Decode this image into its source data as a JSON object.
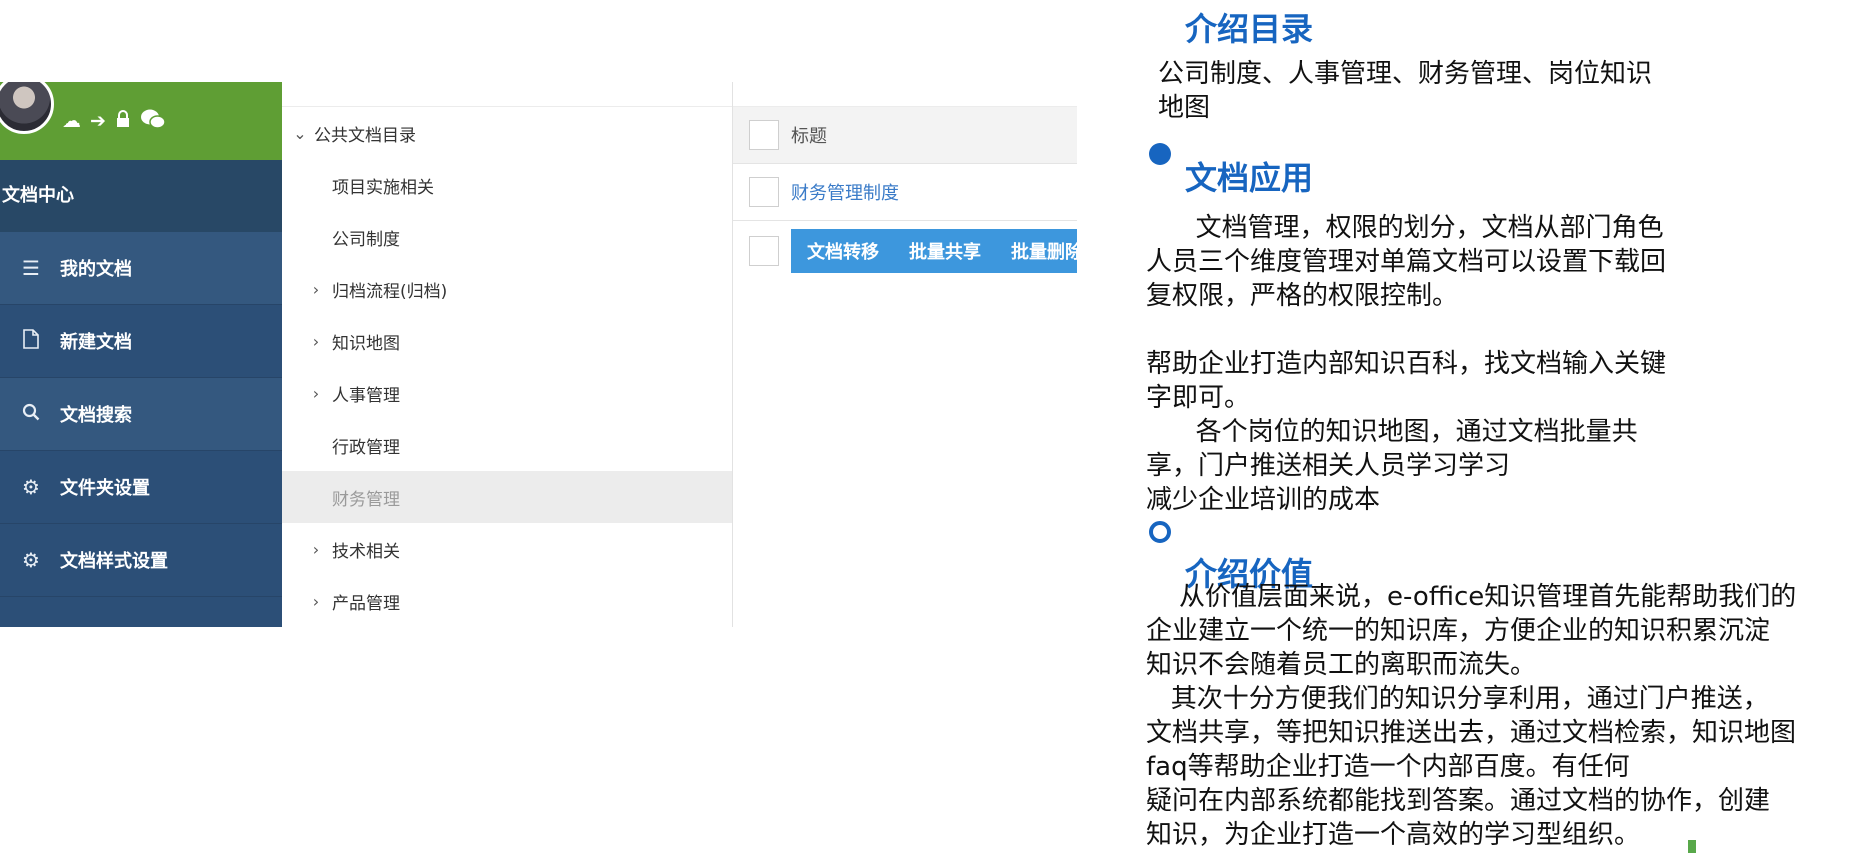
{
  "screenshot": {
    "user_bar": {
      "icons": [
        "cloud-icon",
        "sign-in-icon",
        "lock-icon",
        "wechat-icon"
      ]
    },
    "nav_header": "文档中心",
    "nav_items": [
      {
        "label": "我的文档",
        "icon": "list-icon"
      },
      {
        "label": "新建文档",
        "icon": "file-icon"
      },
      {
        "label": "文档搜索",
        "icon": "search-icon"
      },
      {
        "label": "文件夹设置",
        "icon": "gear-icon"
      },
      {
        "label": "文档样式设置",
        "icon": "gear-icon"
      }
    ],
    "tree": {
      "root": "公共文档目录",
      "items": [
        {
          "label": "项目实施相关",
          "expandable": false
        },
        {
          "label": "公司制度",
          "expandable": false
        },
        {
          "label": "归档流程(归档)",
          "expandable": true
        },
        {
          "label": "知识地图",
          "expandable": true
        },
        {
          "label": "人事管理",
          "expandable": true
        },
        {
          "label": "行政管理",
          "expandable": false
        },
        {
          "label": "财务管理",
          "expandable": false,
          "selected": true
        },
        {
          "label": "技术相关",
          "expandable": true
        },
        {
          "label": "产品管理",
          "expandable": true
        }
      ]
    },
    "list": {
      "header_title": "标题",
      "rows": [
        "财务管理制度"
      ],
      "actions": [
        "文档转移",
        "批量共享",
        "批量删除"
      ]
    }
  },
  "content": {
    "section1": {
      "title": "介绍目录",
      "body": "公司制度、人事管理、财务管理、岗位知识\n地图"
    },
    "section2": {
      "title": "文档应用",
      "body": "      文档管理，权限的划分，文档从部门角色\n人员三个维度管理对单篇文档可以设置下载回\n复权限，严格的权限控制。\n\n帮助企业打造内部知识百科，找文档输入关键\n字即可。\n      各个岗位的知识地图，通过文档批量共\n享，门户推送相关人员学习学习\n减少企业培训的成本"
    },
    "section3": {
      "title": "介绍价值",
      "body": "    从价值层面来说，e-office知识管理首先能帮助我们的\n企业建立一个统一的知识库，方便企业的知识积累沉淀\n知识不会随着员工的离职而流失。\n   其次十分方便我们的知识分享利用，通过门户推送，\n文档共享，等把知识推送出去，通过文档检索，知识地图\nfaq等帮助企业打造一个内部百度。有任何\n疑问在内部系统都能找到答案。通过文档的协作，创建\n知识，为企业打造一个高效的学习型组织。"
    }
  },
  "colors": {
    "accent": "#1765c0",
    "nav_bg": "#2c4f77",
    "user_bar": "#5f9e34",
    "action_bar": "#3d97dd",
    "link": "#3a7bc8"
  }
}
